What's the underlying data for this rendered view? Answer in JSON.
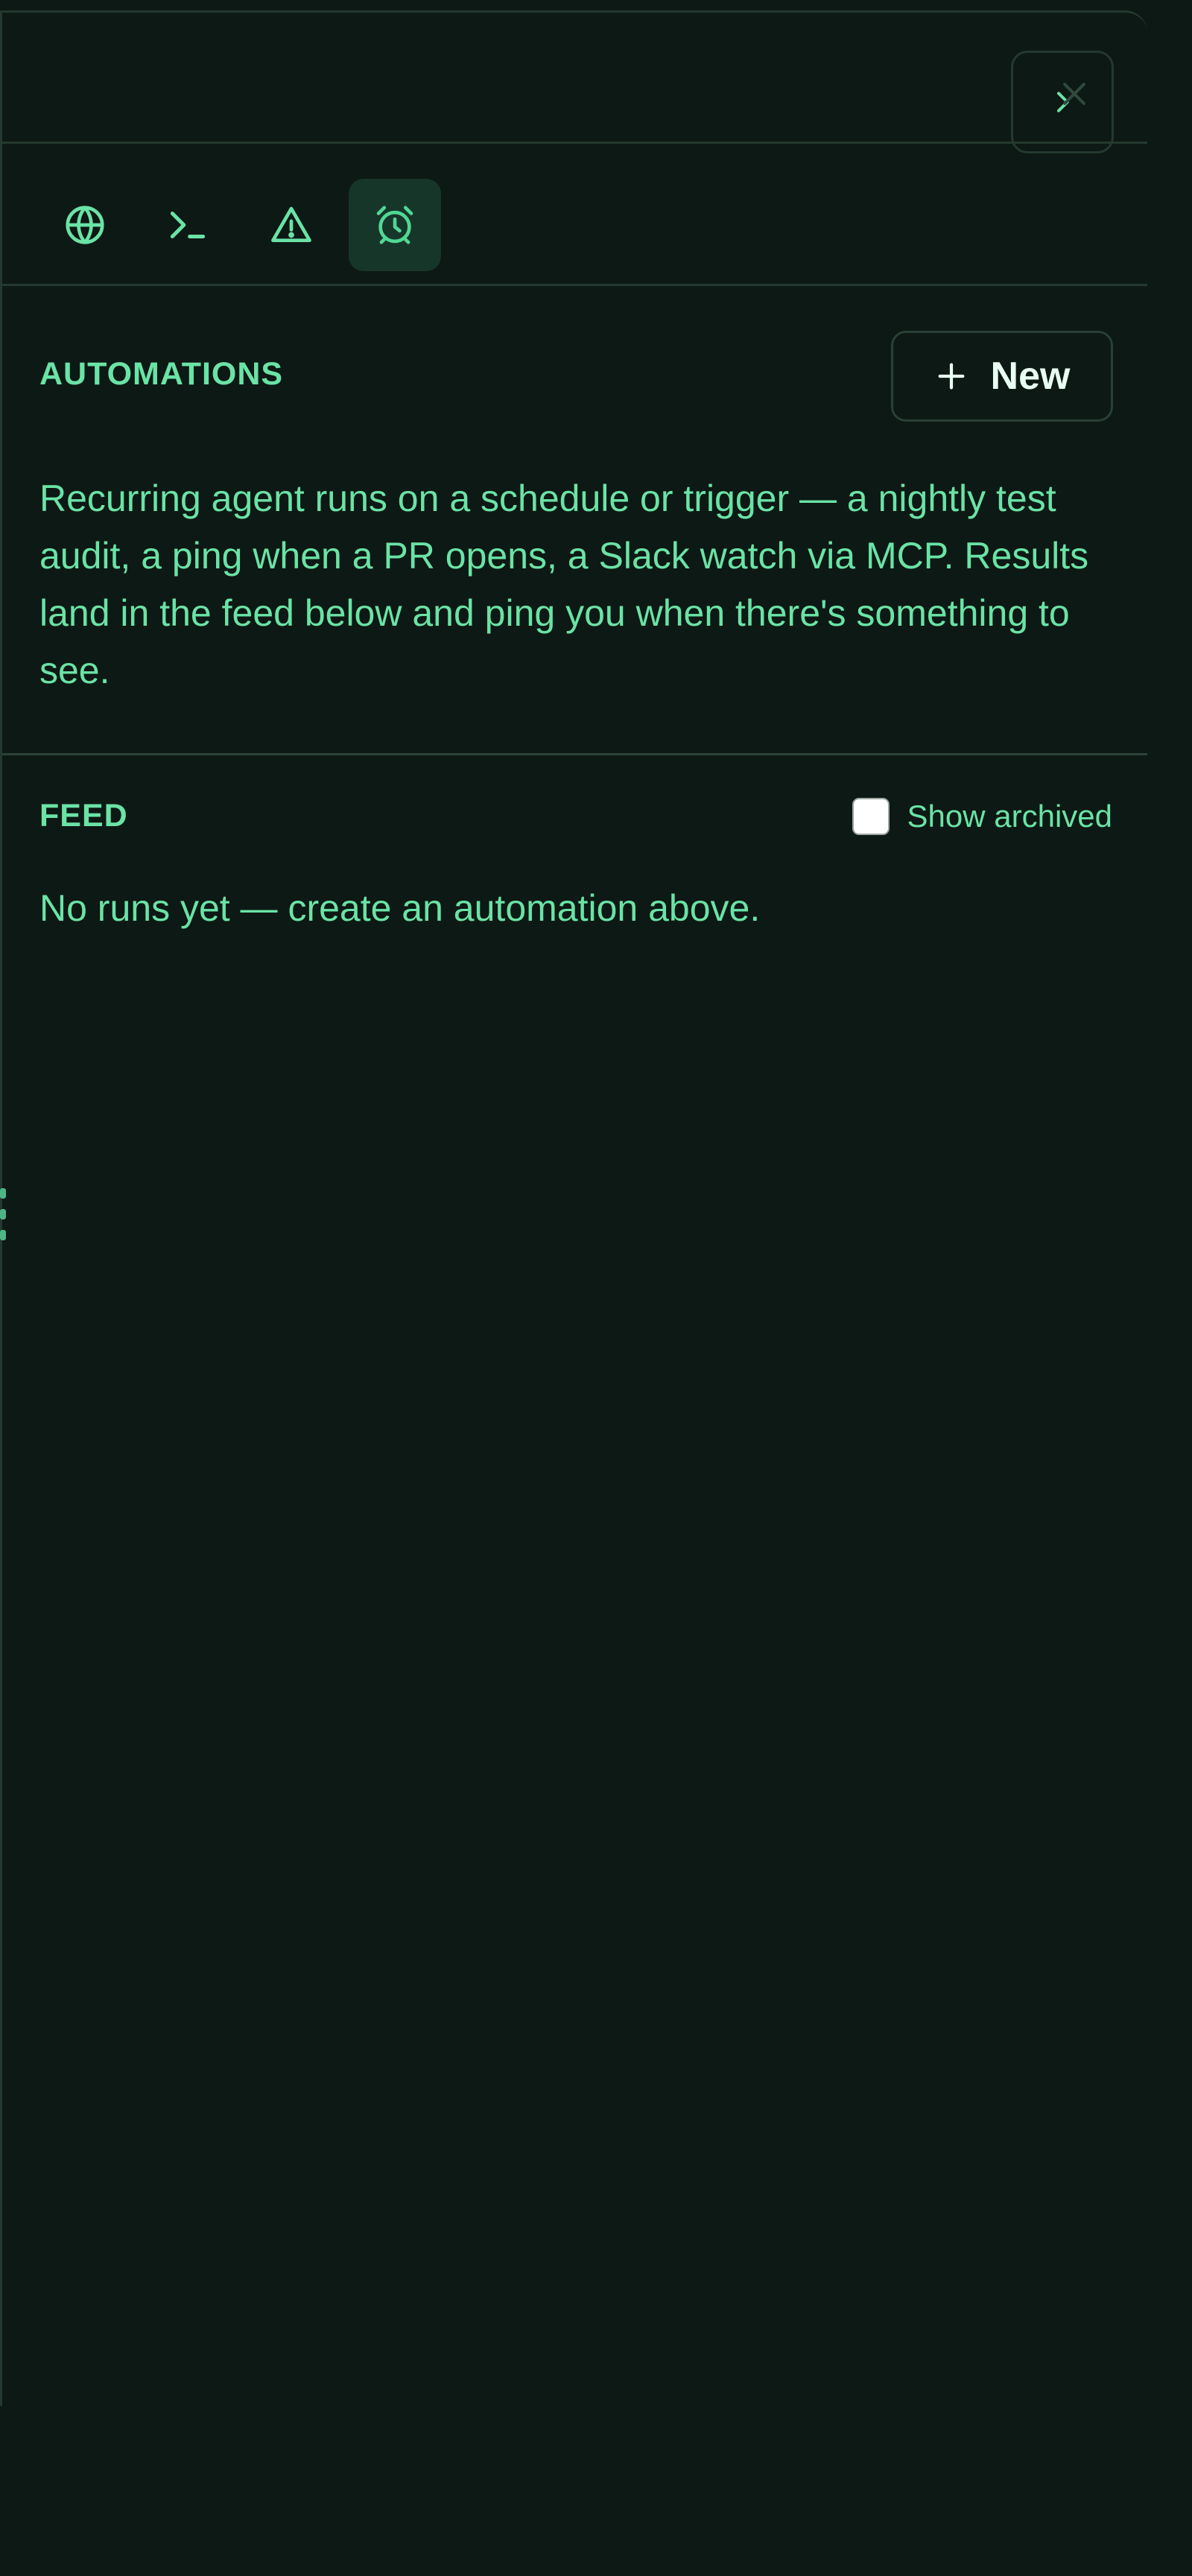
{
  "colors": {
    "background": "#0d1914",
    "border": "#24392f",
    "accent": "#6ae3a6",
    "active_tab": "#17362a",
    "button_text": "#eafff3"
  },
  "header": {
    "collapse_icon": "chevron-right-icon",
    "close_icon": "close-icon"
  },
  "tabs": [
    {
      "icon": "globe-icon",
      "active": false
    },
    {
      "icon": "terminal-icon",
      "active": false
    },
    {
      "icon": "warning-icon",
      "active": false
    },
    {
      "icon": "alarm-clock-icon",
      "active": true
    }
  ],
  "automations": {
    "title": "AUTOMATIONS",
    "new_button_label": "New",
    "new_button_icon": "plus-icon",
    "description": "Recurring agent runs on a schedule or trigger — a nightly test audit, a ping when a PR opens, a Slack watch via MCP. Results land in the feed below and ping you when there's something to see."
  },
  "feed": {
    "title": "FEED",
    "show_archived_label": "Show archived",
    "show_archived_checked": false,
    "empty_message": "No runs yet — create an automation above."
  }
}
